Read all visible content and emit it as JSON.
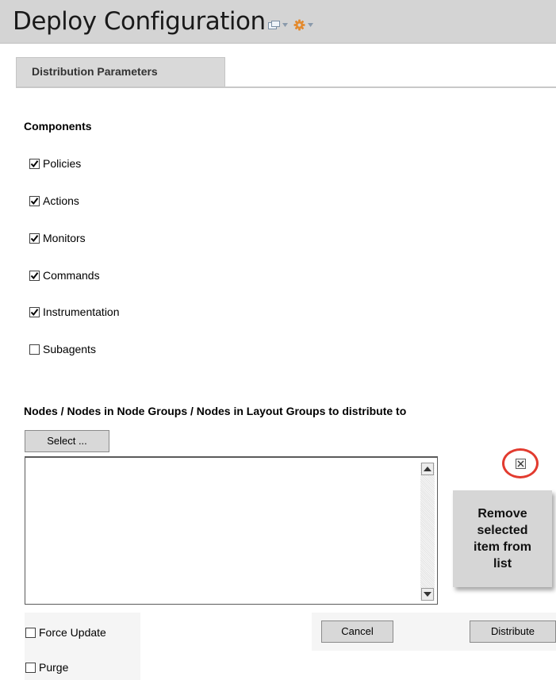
{
  "header": {
    "title": "Deploy Configuration",
    "icons": [
      "window-icon",
      "chevron-down-icon",
      "gear-icon",
      "chevron-down-icon"
    ]
  },
  "tabs": [
    {
      "label": "Distribution Parameters",
      "active": true
    }
  ],
  "components": {
    "heading": "Components",
    "items": [
      {
        "label": "Policies",
        "checked": true
      },
      {
        "label": "Actions",
        "checked": true
      },
      {
        "label": "Monitors",
        "checked": true
      },
      {
        "label": "Commands",
        "checked": true
      },
      {
        "label": "Instrumentation",
        "checked": true
      },
      {
        "label": "Subagents",
        "checked": false
      }
    ]
  },
  "nodes": {
    "heading": "Nodes / Nodes in Node Groups / Nodes in Layout Groups to distribute to",
    "select_button": "Select ...",
    "list_items": [],
    "remove_icon": "remove-icon",
    "remove_tooltip": "Remove selected item from list"
  },
  "options": [
    {
      "label": "Force Update",
      "checked": false
    },
    {
      "label": "Purge",
      "checked": false
    }
  ],
  "actions": {
    "cancel_label": "Cancel",
    "distribute_label": "Distribute"
  },
  "colors": {
    "title_bar": "#d4d4d4",
    "tab_background": "#d9d9d9",
    "highlight_circle": "#e23b2f",
    "tooltip_background": "#d6d6d6"
  }
}
